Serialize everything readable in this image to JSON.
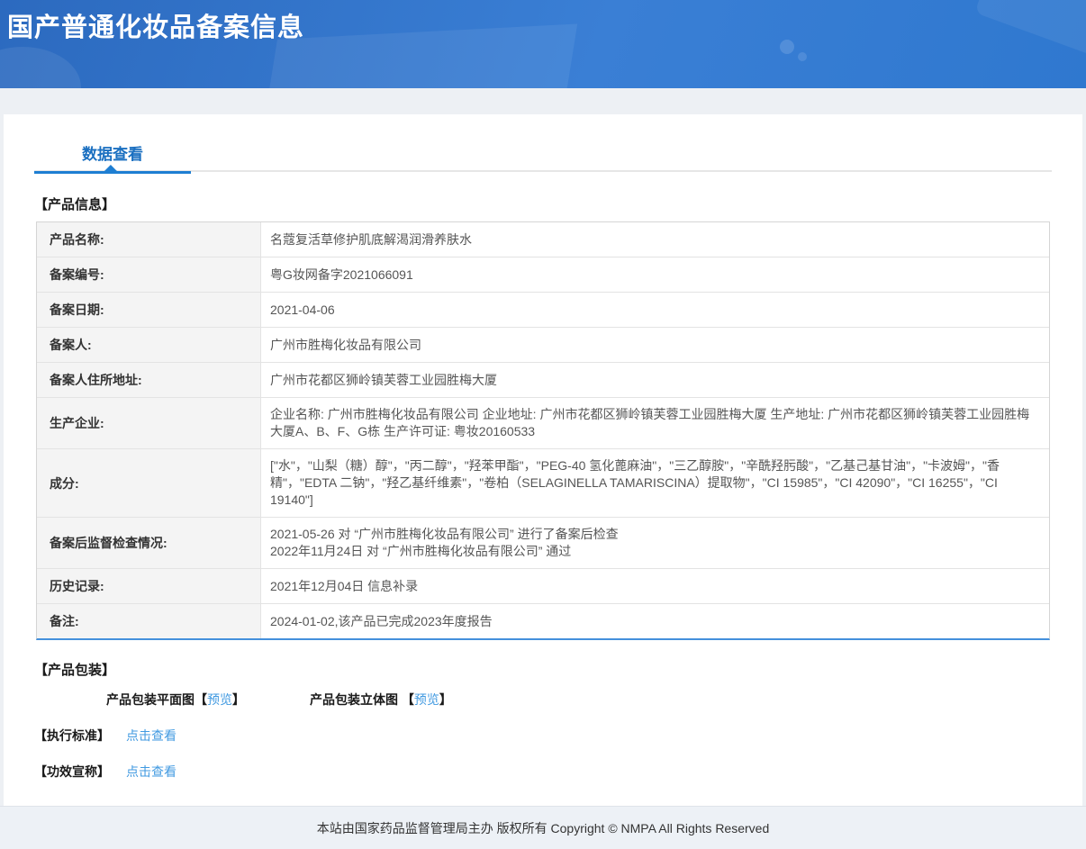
{
  "header": {
    "title": "国产普通化妆品备案信息"
  },
  "tabs": {
    "data_view_label": "数据查看"
  },
  "sections": {
    "product_info_title": "【产品信息】",
    "packaging_title": "【产品包装】",
    "standard_title": "【执行标准】",
    "efficacy_title": "【功效宣称】"
  },
  "product_table": {
    "rows": [
      {
        "label": "产品名称:",
        "value": "名蔻复活草修护肌底解渴润滑养肤水"
      },
      {
        "label": "备案编号:",
        "value": "粤G妆网备字2021066091"
      },
      {
        "label": "备案日期:",
        "value": "2021-04-06"
      },
      {
        "label": "备案人:",
        "value": "广州市胜梅化妆品有限公司"
      },
      {
        "label": "备案人住所地址:",
        "value": "广州市花都区狮岭镇芙蓉工业园胜梅大厦"
      },
      {
        "label": "生产企业:",
        "value": "企业名称: 广州市胜梅化妆品有限公司 企业地址: 广州市花都区狮岭镇芙蓉工业园胜梅大厦 生产地址: 广州市花都区狮岭镇芙蓉工业园胜梅大厦A、B、F、G栋 生产许可证: 粤妆20160533"
      },
      {
        "label": "成分:",
        "value": "[\"水\"，\"山梨（糖）醇\"，\"丙二醇\"，\"羟苯甲酯\"，\"PEG-40 氢化蓖麻油\"，\"三乙醇胺\"，\"辛酰羟肟酸\"，\"乙基己基甘油\"，\"卡波姆\"，\"香精\"，\"EDTA 二钠\"，\"羟乙基纤维素\"，\"卷柏（SELAGINELLA TAMARISCINA）提取物\"，\"CI 15985\"，\"CI 42090\"，\"CI 16255\"，\"CI 19140\"]"
      },
      {
        "label": "备案后监督检查情况:",
        "value": "2021-05-26 对 “广州市胜梅化妆品有限公司” 进行了备案后检查\n2022年11月24日 对 “广州市胜梅化妆品有限公司” 通过"
      },
      {
        "label": "历史记录:",
        "value": "2021年12月04日 信息补录"
      },
      {
        "label": "备注:",
        "value": "2024-01-02,该产品已完成2023年度报告"
      }
    ]
  },
  "packaging": {
    "plan_label": "产品包装平面图【",
    "plan_link": "预览",
    "plan_close": "】",
    "solid_label": "产品包装立体图 【",
    "solid_link": "预览",
    "solid_close": "】"
  },
  "links": {
    "standard_link": "点击查看",
    "efficacy_link": "点击查看"
  },
  "footer": {
    "copyright": "本站由国家药品监督管理局主办 版权所有 Copyright © NMPA All Rights Reserved"
  },
  "colors": {
    "header_gradient_start": "#2c6abf",
    "header_gradient_end": "#3a7fd5",
    "accent_blue": "#1a6fc0",
    "tab_underline": "#1e7ed2",
    "table_bottom_border": "#4490dc",
    "link_blue": "#419ae1",
    "label_cell_bg": "#f4f4f4",
    "page_bg": "#edf0f4",
    "footer_bg": "#edf1f6"
  }
}
